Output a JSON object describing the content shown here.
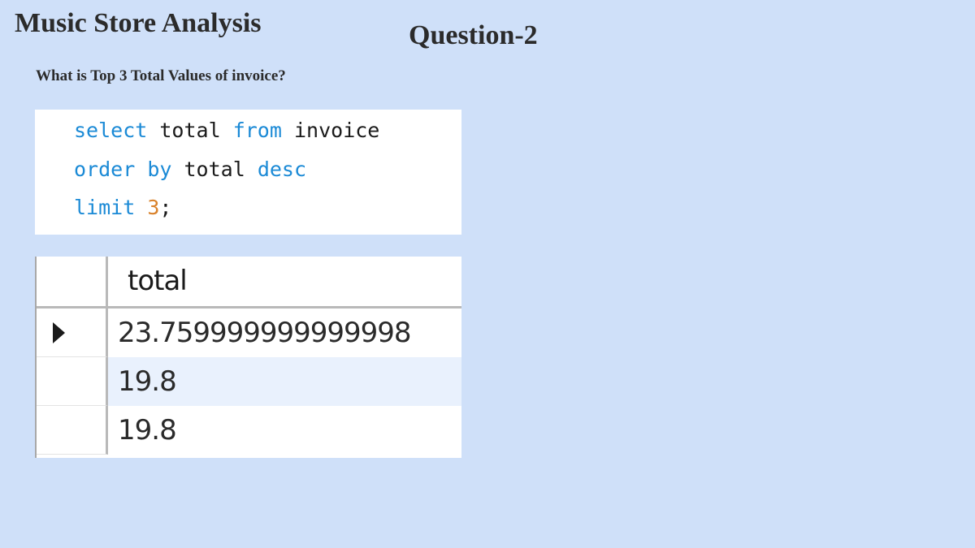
{
  "slide": {
    "title": "Music Store Analysis",
    "question_label": "Question-2",
    "question_text": "What is Top 3 Total Values of invoice?"
  },
  "sql": {
    "line1": {
      "kw1": "select",
      "id1": "total",
      "kw2": "from",
      "id2": "invoice"
    },
    "line2": {
      "kw1": "order",
      "kw2": "by",
      "id1": "total",
      "kw3": "desc"
    },
    "line3": {
      "kw1": "limit",
      "num": "3",
      "punct": ";"
    }
  },
  "result": {
    "column_header": "total",
    "selected_row_icon": "row-pointer-icon",
    "rows": [
      {
        "value": "23.759999999999998"
      },
      {
        "value": "19.8"
      },
      {
        "value": "19.8"
      }
    ]
  },
  "colors": {
    "background": "#cfe0f9",
    "keyword": "#1b8ad6",
    "number": "#d9822b",
    "alt_row": "#e9f1fd"
  }
}
